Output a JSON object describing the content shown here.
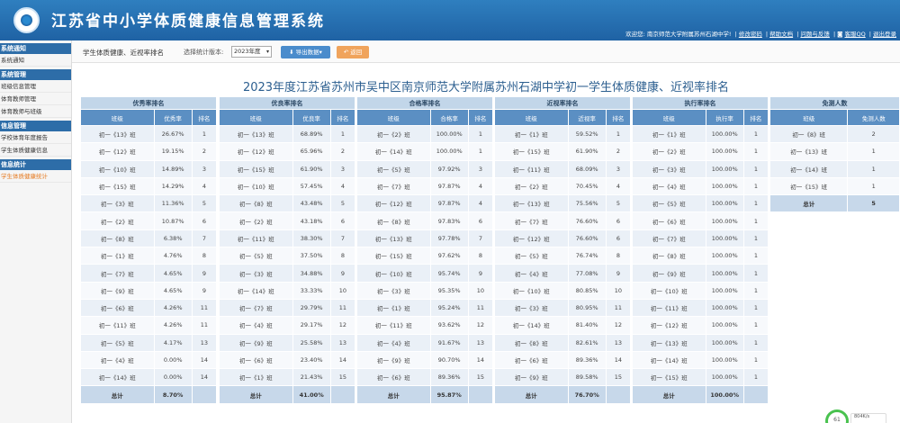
{
  "header": {
    "title": "江苏省中小学体质健康信息管理系统",
    "welcome": "欢迎您: 南京师范大学附属苏州石湖中学!",
    "links": [
      "修改密码",
      "帮助文档",
      "问题与反馈",
      "客服QQ",
      "退出登录"
    ]
  },
  "sidebar": {
    "sections": [
      {
        "title": "系统通知",
        "items": [
          "系统通知"
        ]
      },
      {
        "title": "系统管理",
        "items": [
          "班级信息管理",
          "体育教师管理",
          "体育教师与班级"
        ]
      },
      {
        "title": "信息管理",
        "items": [
          "学校体育年度报告",
          "学生体质健康信息"
        ]
      },
      {
        "title": "信息统计",
        "items": [
          "学生体质健康统计"
        ]
      }
    ],
    "active_item": "学生体质健康统计"
  },
  "toolbar": {
    "page_title": "学生体质健康、近视率排名",
    "version_label": "选择统计版本:",
    "version_value": "2023年度",
    "export_label": "导出数据▾",
    "back_label": "返回"
  },
  "report_title": "2023年度江苏省苏州市吴中区南京师范大学附属苏州石湖中学初一学生体质健康、近视率排名",
  "tables": [
    {
      "caption": "优秀率排名",
      "headers": [
        "班级",
        "优秀率",
        "排名"
      ],
      "rows": [
        [
          "初一《13》班",
          "26.67%",
          "1"
        ],
        [
          "初一《12》班",
          "19.15%",
          "2"
        ],
        [
          "初一《10》班",
          "14.89%",
          "3"
        ],
        [
          "初一《15》班",
          "14.29%",
          "4"
        ],
        [
          "初一《3》班",
          "11.36%",
          "5"
        ],
        [
          "初一《2》班",
          "10.87%",
          "6"
        ],
        [
          "初一《8》班",
          "6.38%",
          "7"
        ],
        [
          "初一《1》班",
          "4.76%",
          "8"
        ],
        [
          "初一《7》班",
          "4.65%",
          "9"
        ],
        [
          "初一《9》班",
          "4.65%",
          "9"
        ],
        [
          "初一《6》班",
          "4.26%",
          "11"
        ],
        [
          "初一《11》班",
          "4.26%",
          "11"
        ],
        [
          "初一《5》班",
          "4.17%",
          "13"
        ],
        [
          "初一《4》班",
          "0.00%",
          "14"
        ],
        [
          "初一《14》班",
          "0.00%",
          "14"
        ]
      ],
      "total": [
        "总计",
        "8.70%",
        ""
      ]
    },
    {
      "caption": "优良率排名",
      "headers": [
        "班级",
        "优良率",
        "排名"
      ],
      "rows": [
        [
          "初一《13》班",
          "68.89%",
          "1"
        ],
        [
          "初一《12》班",
          "65.96%",
          "2"
        ],
        [
          "初一《15》班",
          "61.90%",
          "3"
        ],
        [
          "初一《10》班",
          "57.45%",
          "4"
        ],
        [
          "初一《8》班",
          "43.48%",
          "5"
        ],
        [
          "初一《2》班",
          "43.18%",
          "6"
        ],
        [
          "初一《11》班",
          "38.30%",
          "7"
        ],
        [
          "初一《5》班",
          "37.50%",
          "8"
        ],
        [
          "初一《3》班",
          "34.88%",
          "9"
        ],
        [
          "初一《14》班",
          "33.33%",
          "10"
        ],
        [
          "初一《7》班",
          "29.79%",
          "11"
        ],
        [
          "初一《4》班",
          "29.17%",
          "12"
        ],
        [
          "初一《9》班",
          "25.58%",
          "13"
        ],
        [
          "初一《6》班",
          "23.40%",
          "14"
        ],
        [
          "初一《1》班",
          "21.43%",
          "15"
        ]
      ],
      "total": [
        "总计",
        "41.00%",
        ""
      ]
    },
    {
      "caption": "合格率排名",
      "headers": [
        "班级",
        "合格率",
        "排名"
      ],
      "rows": [
        [
          "初一《2》班",
          "100.00%",
          "1"
        ],
        [
          "初一《14》班",
          "100.00%",
          "1"
        ],
        [
          "初一《5》班",
          "97.92%",
          "3"
        ],
        [
          "初一《7》班",
          "97.87%",
          "4"
        ],
        [
          "初一《12》班",
          "97.87%",
          "4"
        ],
        [
          "初一《8》班",
          "97.83%",
          "6"
        ],
        [
          "初一《13》班",
          "97.78%",
          "7"
        ],
        [
          "初一《15》班",
          "97.62%",
          "8"
        ],
        [
          "初一《10》班",
          "95.74%",
          "9"
        ],
        [
          "初一《3》班",
          "95.35%",
          "10"
        ],
        [
          "初一《1》班",
          "95.24%",
          "11"
        ],
        [
          "初一《11》班",
          "93.62%",
          "12"
        ],
        [
          "初一《4》班",
          "91.67%",
          "13"
        ],
        [
          "初一《9》班",
          "90.70%",
          "14"
        ],
        [
          "初一《6》班",
          "89.36%",
          "15"
        ]
      ],
      "total": [
        "总计",
        "95.87%",
        ""
      ]
    },
    {
      "caption": "近视率排名",
      "headers": [
        "班级",
        "近视率",
        "排名"
      ],
      "rows": [
        [
          "初一《1》班",
          "59.52%",
          "1"
        ],
        [
          "初一《15》班",
          "61.90%",
          "2"
        ],
        [
          "初一《11》班",
          "68.09%",
          "3"
        ],
        [
          "初一《2》班",
          "70.45%",
          "4"
        ],
        [
          "初一《13》班",
          "75.56%",
          "5"
        ],
        [
          "初一《7》班",
          "76.60%",
          "6"
        ],
        [
          "初一《12》班",
          "76.60%",
          "6"
        ],
        [
          "初一《5》班",
          "76.74%",
          "8"
        ],
        [
          "初一《4》班",
          "77.08%",
          "9"
        ],
        [
          "初一《10》班",
          "80.85%",
          "10"
        ],
        [
          "初一《3》班",
          "80.95%",
          "11"
        ],
        [
          "初一《14》班",
          "81.40%",
          "12"
        ],
        [
          "初一《8》班",
          "82.61%",
          "13"
        ],
        [
          "初一《6》班",
          "89.36%",
          "14"
        ],
        [
          "初一《9》班",
          "89.58%",
          "15"
        ]
      ],
      "total": [
        "总计",
        "76.70%",
        ""
      ]
    },
    {
      "caption": "执行率排名",
      "headers": [
        "班级",
        "执行率",
        "排名"
      ],
      "rows": [
        [
          "初一《1》班",
          "100.00%",
          "1"
        ],
        [
          "初一《2》班",
          "100.00%",
          "1"
        ],
        [
          "初一《3》班",
          "100.00%",
          "1"
        ],
        [
          "初一《4》班",
          "100.00%",
          "1"
        ],
        [
          "初一《5》班",
          "100.00%",
          "1"
        ],
        [
          "初一《6》班",
          "100.00%",
          "1"
        ],
        [
          "初一《7》班",
          "100.00%",
          "1"
        ],
        [
          "初一《8》班",
          "100.00%",
          "1"
        ],
        [
          "初一《9》班",
          "100.00%",
          "1"
        ],
        [
          "初一《10》班",
          "100.00%",
          "1"
        ],
        [
          "初一《11》班",
          "100.00%",
          "1"
        ],
        [
          "初一《12》班",
          "100.00%",
          "1"
        ],
        [
          "初一《13》班",
          "100.00%",
          "1"
        ],
        [
          "初一《14》班",
          "100.00%",
          "1"
        ],
        [
          "初一《15》班",
          "100.00%",
          "1"
        ]
      ],
      "total": [
        "总计",
        "100.00%",
        ""
      ]
    },
    {
      "caption": "免测人数",
      "headers": [
        "班级",
        "免测人数"
      ],
      "rows": [
        [
          "初一《8》班",
          "2"
        ],
        [
          "初一《13》班",
          "1"
        ],
        [
          "初一《14》班",
          "1"
        ],
        [
          "初一《15》班",
          "1"
        ]
      ],
      "total": [
        "总计",
        "5"
      ]
    }
  ],
  "network": {
    "percent": "61",
    "speed": "804K/s"
  }
}
